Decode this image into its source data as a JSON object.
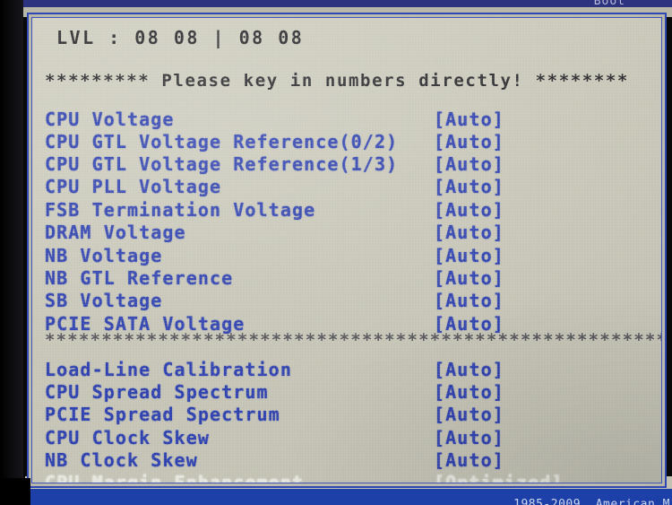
{
  "bios": {
    "top_bar_label": "Boot",
    "copyright": "1985-2009, American M",
    "lvl_line": "LVL : 08 08 | 08 08",
    "banner": "********* Please key in numbers directly! ********",
    "separator": "*********************************************************",
    "value_auto": "[Auto]",
    "value_optimized": "[Optimized]",
    "group_voltage": [
      {
        "label": "CPU Voltage",
        "value": "[Auto]",
        "disabled": false
      },
      {
        "label": "CPU GTL Voltage Reference(0/2)",
        "value": "[Auto]",
        "disabled": false
      },
      {
        "label": "CPU GTL Voltage Reference(1/3)",
        "value": "[Auto]",
        "disabled": false
      },
      {
        "label": "CPU PLL Voltage",
        "value": "[Auto]",
        "disabled": false
      },
      {
        "label": "FSB Termination Voltage",
        "value": "[Auto]",
        "disabled": false
      },
      {
        "label": "DRAM Voltage",
        "value": "[Auto]",
        "disabled": false
      },
      {
        "label": "NB Voltage",
        "value": "[Auto]",
        "disabled": false
      },
      {
        "label": "NB GTL Reference",
        "value": "[Auto]",
        "disabled": false
      },
      {
        "label": "SB Voltage",
        "value": "[Auto]",
        "disabled": false
      },
      {
        "label": "PCIE SATA Voltage",
        "value": "[Auto]",
        "disabled": false
      }
    ],
    "group_tuning": [
      {
        "label": "Load-Line Calibration",
        "value": "[Auto]",
        "disabled": false
      },
      {
        "label": "CPU Spread Spectrum",
        "value": "[Auto]",
        "disabled": false
      },
      {
        "label": "PCIE Spread Spectrum",
        "value": "[Auto]",
        "disabled": false
      },
      {
        "label": "CPU Clock Skew",
        "value": "[Auto]",
        "disabled": false
      },
      {
        "label": "NB Clock Skew",
        "value": "[Auto]",
        "disabled": false
      },
      {
        "label": "CPU Margin Enhancement",
        "value": "[Optimized]",
        "disabled": true
      }
    ]
  },
  "colors": {
    "text_blue": "#2c3fae",
    "text_dark": "#2a2a2d",
    "text_disabled": "#e6e5dc",
    "panel_bg": "#c7c6b8",
    "border_blue": "#2f47b4",
    "chrome_blue": "#1c3fa8"
  }
}
